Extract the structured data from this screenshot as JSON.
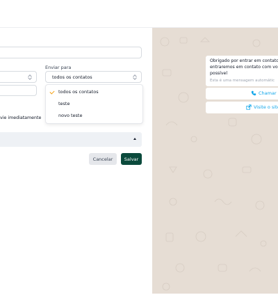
{
  "form": {
    "send_to_label": "Enviar para",
    "send_to_value": "todos os contatos",
    "send_now_label": "vie imediatamente",
    "cancel_label": "Cancelar",
    "save_label": "Salvar"
  },
  "dropdown": {
    "options": [
      "todos os contatos",
      "teste",
      "novo teste"
    ],
    "selected_index": 0
  },
  "chat_preview": {
    "message": "Obrigado por entrar em contato\nentraremos em contato com voc\npossível",
    "note": "Esta é uma mensagem automátic",
    "call_label": "Chamar",
    "visit_label": "Visite o site"
  },
  "colors": {
    "save_button": "#0b4a3c",
    "cta_text": "#0ea5e9",
    "check": "#f59e0b",
    "chat_background": "#e6ddd4"
  },
  "icons": [
    "check-icon",
    "chevron-up-icon",
    "phone-icon",
    "external-link-icon"
  ]
}
